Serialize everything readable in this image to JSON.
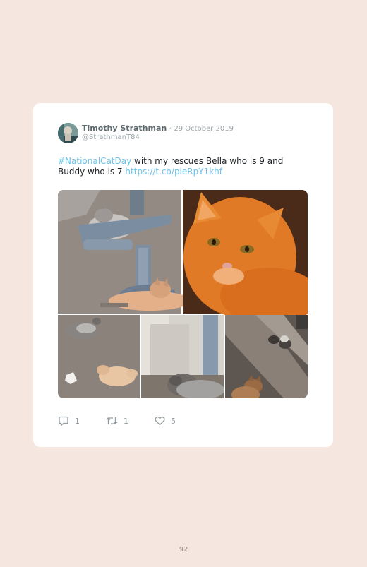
{
  "tweet": {
    "author_name": "Timothy Strathman",
    "separator": "·",
    "date": "29 October 2019",
    "handle": "@StrathmanT84",
    "hashtag": "#NationalCatDay",
    "text_main": " with my rescues Bella who is 9 and Buddy who is 7 ",
    "link": "https://t.co/pleRpY1khf",
    "media_count": 5
  },
  "actions": {
    "reply": {
      "icon": "reply-icon",
      "count": "1"
    },
    "retweet": {
      "icon": "retweet-icon",
      "count": "1"
    },
    "like": {
      "icon": "heart-icon",
      "count": "5"
    }
  },
  "page": {
    "number": "92"
  },
  "colors": {
    "background": "#f5e6df",
    "card": "#ffffff",
    "link": "#6ec3e8",
    "name": "#5f6b70",
    "muted": "#9aa4a8"
  }
}
